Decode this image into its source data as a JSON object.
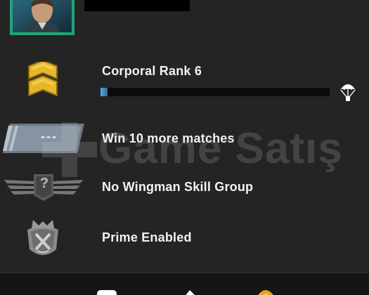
{
  "rank": {
    "label": "Corporal Rank 6",
    "progress": 0.03
  },
  "competitive": {
    "label": "Win 10 more matches",
    "placeholder_badge": "---"
  },
  "wingman": {
    "label": "No Wingman Skill Group",
    "badge_symbol": "?"
  },
  "prime": {
    "label": "Prime Enabled"
  },
  "watermark": {
    "text": "Game Satış"
  },
  "colors": {
    "background": "#242424",
    "avatar_border": "#21a37b",
    "rank_gold": "#e8b628",
    "progress_fill": "#3f8ccb"
  }
}
